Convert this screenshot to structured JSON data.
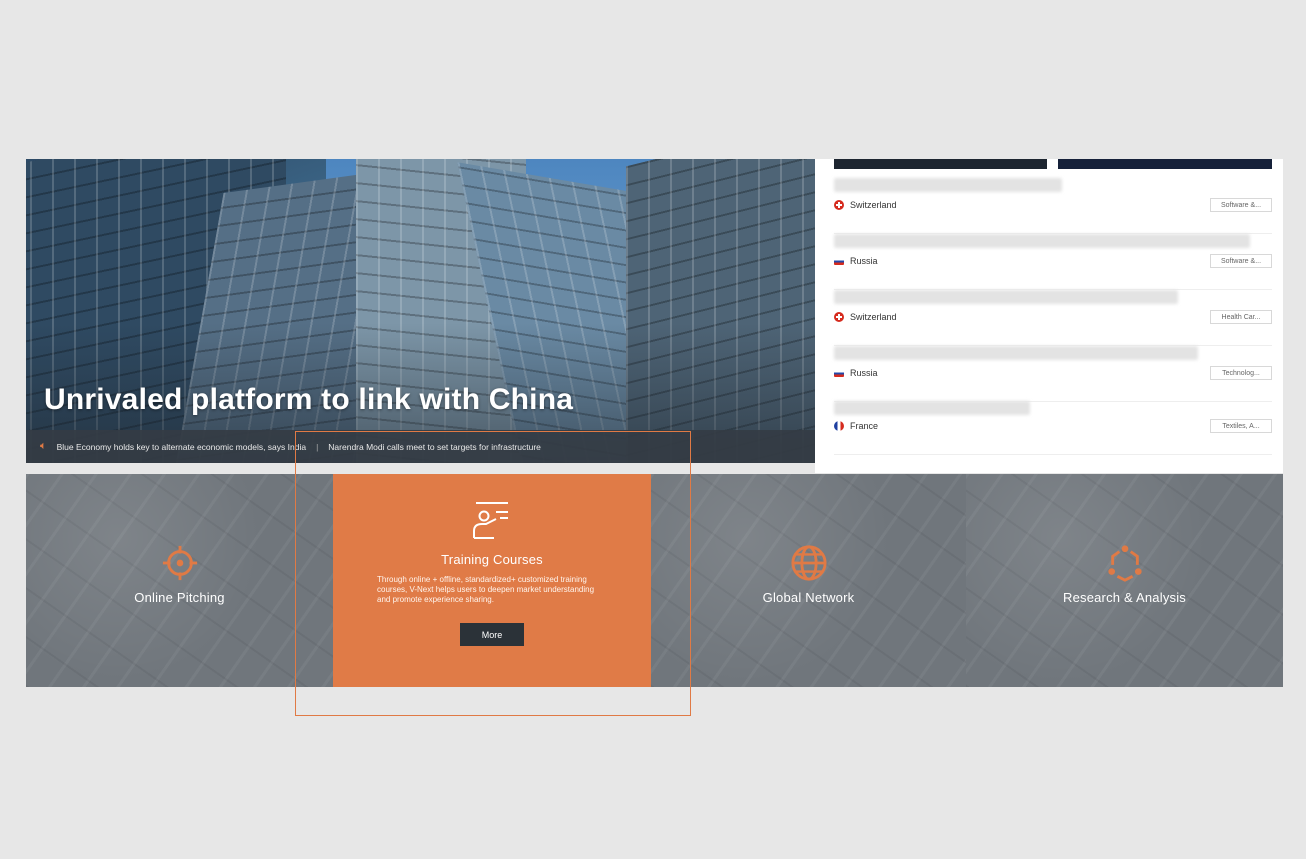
{
  "hero": {
    "title": "Unrivaled platform to link with China",
    "ticker_items": [
      "Blue Economy holds key to alternate economic models, says India",
      "Narendra Modi calls meet to set targets for infrastructure"
    ],
    "ticker_separator": "|"
  },
  "news": {
    "items": [
      {
        "country": "Switzerland",
        "flag": "flag-switzerland-icon",
        "category": "Software &..."
      },
      {
        "country": "Russia",
        "flag": "flag-russia-icon",
        "category": "Software &..."
      },
      {
        "country": "Switzerland",
        "flag": "flag-switzerland-icon",
        "category": "Health Car..."
      },
      {
        "country": "Russia",
        "flag": "flag-russia-icon",
        "category": "Technolog..."
      },
      {
        "country": "France",
        "flag": "flag-france-icon",
        "category": "Textiles, A..."
      }
    ]
  },
  "features": {
    "online_pitching": {
      "title": "Online Pitching",
      "icon": "target-icon"
    },
    "training_courses": {
      "title": "Training Courses",
      "icon": "presenter-icon",
      "description": "Through online + offline, standardized+ customized training courses, V-Next helps users to deepen market understanding and promote experience sharing.",
      "button": "More"
    },
    "global_network": {
      "title": "Global Network",
      "icon": "globe-icon"
    },
    "research": {
      "title": "Research & Analysis",
      "icon": "network-nodes-icon"
    }
  },
  "colors": {
    "accent": "#e07a45",
    "band_gray": "#70767c",
    "button_dark": "#2b3238",
    "page_bg": "#e7e7e7"
  }
}
